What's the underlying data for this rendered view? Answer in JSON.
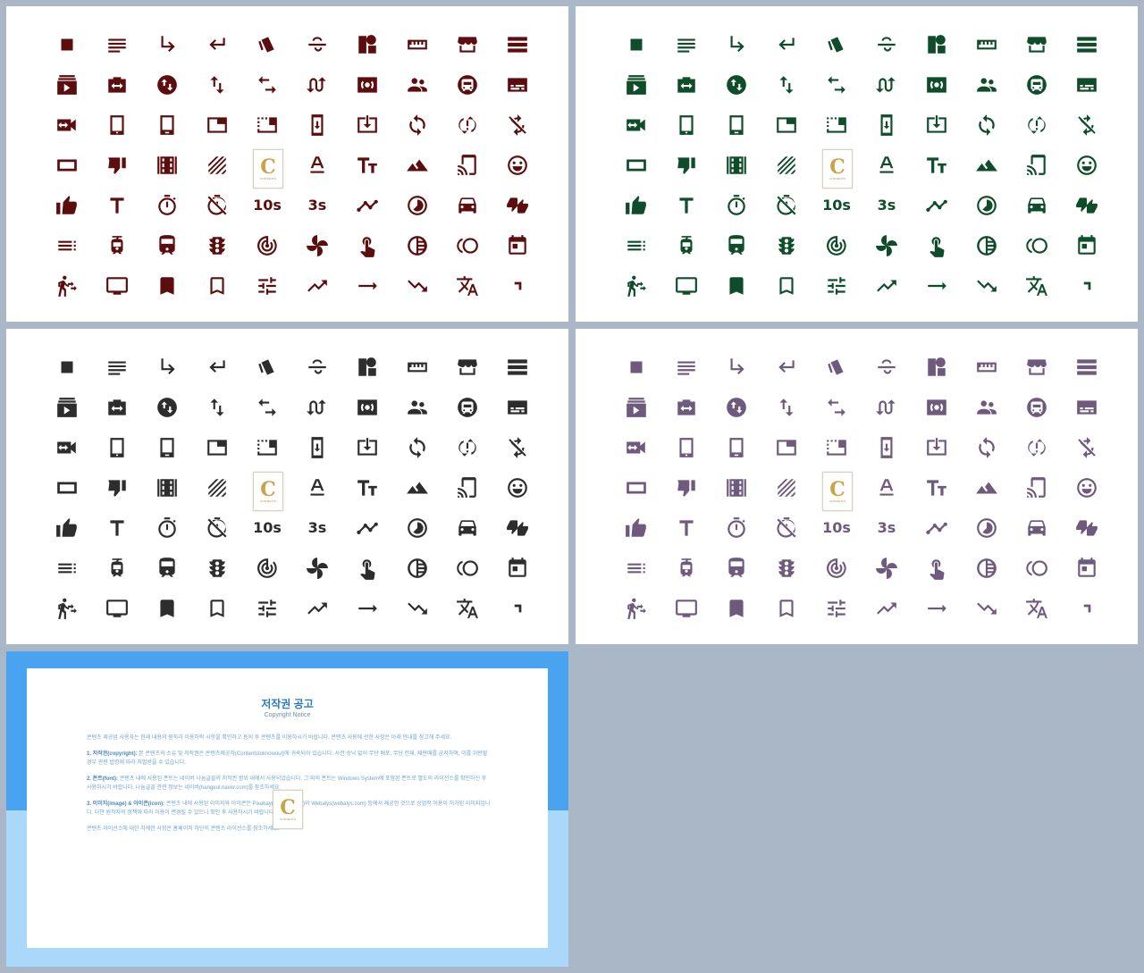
{
  "colors": [
    "#5c0d0d",
    "#0f4d2a",
    "#2d2d2d",
    "#6f5a7e"
  ],
  "icons": [
    "square-icon",
    "notes-icon",
    "subdirectory-arrow-right-icon",
    "keyboard-return-icon",
    "style-icon",
    "strikethrough-icon",
    "shapes-icon",
    "straighten-icon",
    "storefront-icon",
    "storage-icon",
    "subscriptions-icon",
    "settings-ethernet-icon",
    "swap-vertical-circle-icon",
    "swap-vert-icon",
    "swap-horiz-icon",
    "swap-calls-icon",
    "surround-sound-icon",
    "supervisor-account-icon",
    "subway-icon",
    "subtitles-icon",
    "switch-video-icon",
    "tablet-icon",
    "tablet-android-icon",
    "tab-icon",
    "tab-unselected-icon",
    "system-update-icon",
    "system-update-alt-icon",
    "sync-icon",
    "sync-problem-icon",
    "sync-disabled-icon",
    "crop-landscape-icon",
    "thumb-down-icon",
    "theaters-icon",
    "texture-icon",
    "textsms-icon",
    "text-format-icon",
    "text-fields-icon",
    "terrain-icon",
    "tap-and-play-icon",
    "tag-faces-icon",
    "thumb-up-icon",
    "title-icon",
    "timer-icon",
    "timer-off-icon",
    "timer-10-icon",
    "timer-3-icon",
    "timeline-icon",
    "timelapse-icon",
    "time-to-leave-icon",
    "thumbs-up-down-icon",
    "toc-icon",
    "tram-icon",
    "train-icon",
    "traffic-icon",
    "track-changes-icon",
    "toys-icon",
    "touch-app-icon",
    "tonality-icon",
    "toll-icon",
    "today-icon",
    "transfer-within-a-station-icon",
    "tv-icon",
    "bookmark-icon",
    "bookmark-border-icon",
    "tune-icon",
    "trending-up-icon",
    "trending-flat-icon",
    "trending-down-icon",
    "translate-icon",
    "corner-icon"
  ],
  "copyright": {
    "title": "저작권 공고",
    "subtitle": "Copyright Notice",
    "intro": "콘텐츠 제공업 사용자는 현재 내용의 원칙과 이용허락 사항을 확인하고 동의 후 콘텐츠를 이용하시기 바랍니다. 콘텐츠 사용에 관한 사항은 아래 안내를 참고해 주세요.",
    "s1_head": "1. 저작권(copyright):",
    "s1_body": "본 콘텐츠의 소유 및 저작권은 콘텐츠제공자(Contentstoknowout)에 귀속되어 있습니다. 사전 승낙 없이 무단 배포, 무단 전재, 재판매를 금지하며, 이를 위반할 경우 관련 법령에 따라 처벌받을 수 있습니다.",
    "s2_head": "2. 폰트(font):",
    "s2_body": "콘텐츠 내에 사용된 폰트는 네이버 나눔글꼴의 저작권 범위 내에서 사용되었습니다. 그 외의 폰트는 Windows System에 포함된 폰트로 별도의 라이선스를 확인하신 후 사용하시기 바랍니다. 나눔글꼴 관련 정보는 네이버(hangeul.naver.com)를 참조하세요.",
    "s3_head": "3. 이미지(image) & 아이콘(icon):",
    "s3_body": "콘텐츠 내에 사용된 이미지와 아이콘은 Pixabay(pixabay.com)와 Webalys(webalys.com) 등에서 제공한 것으로 상업적 이용이 허가된 이미지입니다. 다만 원작자의 정책에 따라 이용이 변경될 수 있으니 확인 후 사용하시기 바랍니다.",
    "footer": "콘텐츠 라이선스에 대한 자세한 사항은 홈페이지 하단의 콘텐츠 라이선스를 참조하세요."
  }
}
